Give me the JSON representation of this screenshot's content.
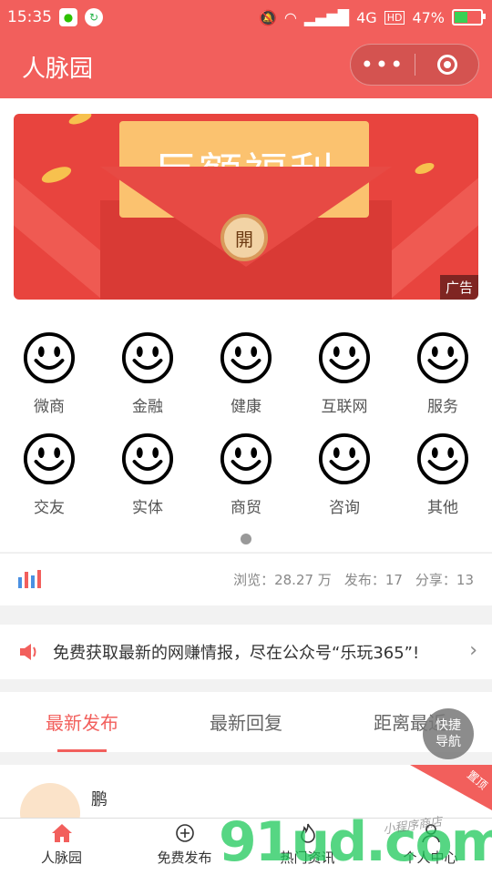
{
  "status_bar": {
    "time": "15:35",
    "network": "4G",
    "hd": "HD",
    "battery_text": "47%",
    "battery_level": 0.47
  },
  "nav": {
    "title": "人脉园",
    "more_glyph": "•••"
  },
  "banner": {
    "text": "巨额福利",
    "seal_text": "開",
    "ad_label": "广告"
  },
  "categories": [
    {
      "label": "微商"
    },
    {
      "label": "金融"
    },
    {
      "label": "健康"
    },
    {
      "label": "互联网"
    },
    {
      "label": "服务"
    },
    {
      "label": "交友"
    },
    {
      "label": "实体"
    },
    {
      "label": "商贸"
    },
    {
      "label": "咨询"
    },
    {
      "label": "其他"
    }
  ],
  "stats": {
    "views": "浏览：28.27 万",
    "posts": "发布：17",
    "shares": "分享：13"
  },
  "notice": {
    "text": "免费获取最新的网赚情报，尽在公众号“乐玩365”!"
  },
  "tabs": [
    {
      "label": "最新发布"
    },
    {
      "label": "最新回复"
    },
    {
      "label": "距离最近"
    }
  ],
  "fab": {
    "line1": "快捷",
    "line2": "导航"
  },
  "post": {
    "name": "鹏",
    "pin_label": "置顶"
  },
  "tabbar": [
    {
      "label": "人脉园"
    },
    {
      "label": "免费发布"
    },
    {
      "label": "热门资讯"
    },
    {
      "label": "个人中心"
    }
  ],
  "watermark": {
    "main": "91ud.com",
    "sub": "小程序商店"
  },
  "colors": {
    "brand": "#f25f5c",
    "fab": "#787878"
  }
}
